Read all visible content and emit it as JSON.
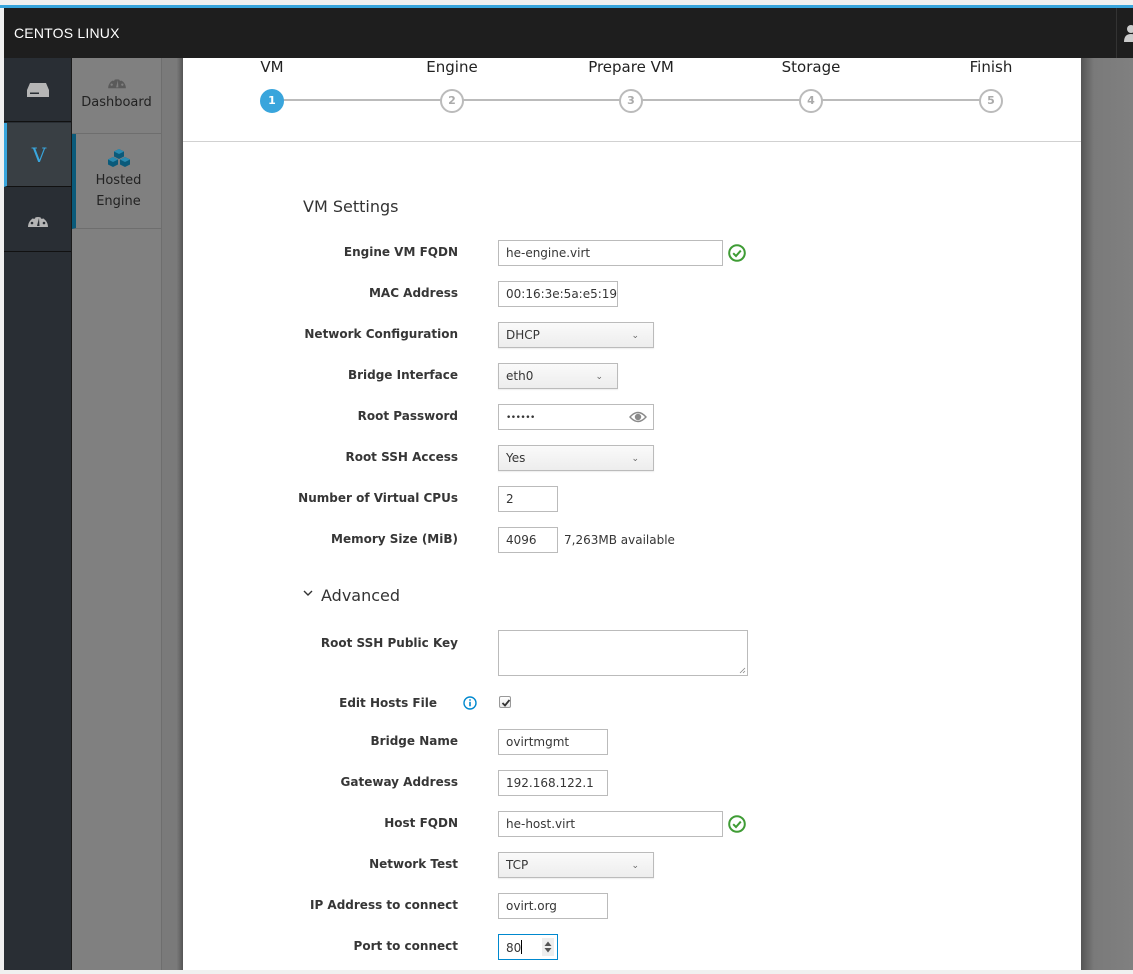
{
  "app": {
    "brand": "CENTOS LINUX"
  },
  "nav_primary": [
    {
      "name": "host",
      "icon": "server-icon",
      "active": false
    },
    {
      "name": "ovirt",
      "icon": "ovirt-v-logo",
      "label": "V",
      "active": true
    },
    {
      "name": "dashboard",
      "icon": "dashboard-icon",
      "active": false
    }
  ],
  "nav_secondary": [
    {
      "label_lines": [
        "Dashboard"
      ],
      "icon": "dashboard-icon",
      "active": false
    },
    {
      "label_lines": [
        "Hosted",
        "Engine"
      ],
      "icon": "cubes-icon",
      "active": true
    }
  ],
  "wizard": {
    "steps": [
      {
        "label": "VM",
        "number": "1",
        "active": true
      },
      {
        "label": "Engine",
        "number": "2",
        "active": false
      },
      {
        "label": "Prepare VM",
        "number": "3",
        "active": false
      },
      {
        "label": "Storage",
        "number": "4",
        "active": false
      },
      {
        "label": "Finish",
        "number": "5",
        "active": false
      }
    ],
    "accent_color": "#39a5dc"
  },
  "vm_settings": {
    "title": "VM Settings",
    "engine_fqdn": {
      "label": "Engine VM FQDN",
      "value": "he-engine.virt",
      "valid": true
    },
    "mac_address": {
      "label": "MAC Address",
      "value": "00:16:3e:5a:e5:19"
    },
    "network_config": {
      "label": "Network Configuration",
      "value": "DHCP"
    },
    "bridge_interface": {
      "label": "Bridge Interface",
      "value": "eth0"
    },
    "root_password": {
      "label": "Root Password",
      "value": "••••••"
    },
    "root_ssh_access": {
      "label": "Root SSH Access",
      "value": "Yes"
    },
    "vcpus": {
      "label": "Number of Virtual CPUs",
      "value": "2"
    },
    "memory": {
      "label": "Memory Size (MiB)",
      "value": "4096",
      "hint": "7,263MB available"
    }
  },
  "advanced": {
    "title": "Advanced",
    "expanded": true,
    "ssh_public_key": {
      "label": "Root SSH Public Key",
      "value": ""
    },
    "edit_hosts_file": {
      "label": "Edit Hosts File",
      "checked": true
    },
    "bridge_name": {
      "label": "Bridge Name",
      "value": "ovirtmgmt"
    },
    "gateway": {
      "label": "Gateway Address",
      "value": "192.168.122.1"
    },
    "host_fqdn": {
      "label": "Host FQDN",
      "value": "he-host.virt",
      "valid": true
    },
    "network_test": {
      "label": "Network Test",
      "value": "TCP"
    },
    "ip_to_connect": {
      "label": "IP Address to connect",
      "value": "ovirt.org"
    },
    "port_to_connect": {
      "label": "Port to connect",
      "value": "80"
    }
  },
  "colors": {
    "success": "#3f9c35",
    "info": "#0088ce",
    "topbar": "#1e1e1e"
  }
}
